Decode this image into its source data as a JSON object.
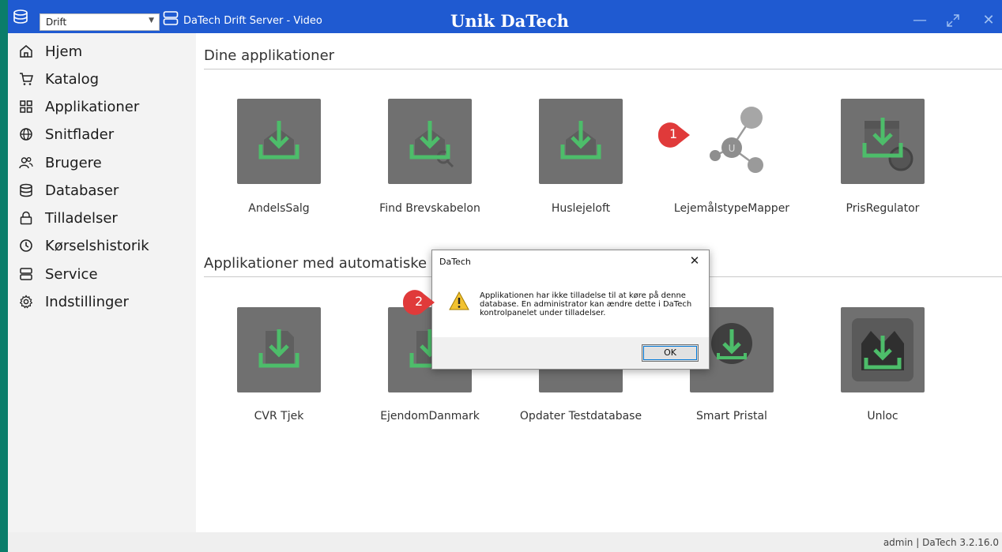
{
  "titlebar": {
    "db_select": "Drift",
    "server_name": "DaTech Drift Server - Video",
    "brand": "Unik DaTech"
  },
  "sidebar": {
    "items": [
      {
        "label": "Hjem",
        "icon": "home-icon"
      },
      {
        "label": "Katalog",
        "icon": "cart-icon"
      },
      {
        "label": "Applikationer",
        "icon": "apps-grid-icon"
      },
      {
        "label": "Snitflader",
        "icon": "globe-icon"
      },
      {
        "label": "Brugere",
        "icon": "users-icon"
      },
      {
        "label": "Databaser",
        "icon": "database-icon"
      },
      {
        "label": "Tilladelser",
        "icon": "lock-icon"
      },
      {
        "label": "Kørselshistorik",
        "icon": "clock-icon"
      },
      {
        "label": "Service",
        "icon": "server-icon"
      },
      {
        "label": "Indstillinger",
        "icon": "gear-icon"
      }
    ]
  },
  "main": {
    "section1_title": "Dine applikationer",
    "section1_apps": [
      {
        "label": "AndelsSalg",
        "icon": "download-tray-icon"
      },
      {
        "label": "Find Brevskabelon",
        "icon": "download-search-icon"
      },
      {
        "label": "Huslejeloft",
        "icon": "download-tray-icon"
      },
      {
        "label": "LejemålstypeMapper",
        "icon": "molecule-icon"
      },
      {
        "label": "PrisRegulator",
        "icon": "download-calendar-icon"
      }
    ],
    "section2_title": "Applikationer med automatiske kø",
    "section2_apps": [
      {
        "label": "CVR Tjek",
        "icon": "download-tray-icon"
      },
      {
        "label": "EjendomDanmark",
        "icon": "download-tray-icon"
      },
      {
        "label": "Opdater Testdatabase",
        "icon": "download-tray-icon"
      },
      {
        "label": "Smart Pristal",
        "icon": "download-circle-icon"
      },
      {
        "label": "Unloc",
        "icon": "download-house-icon"
      }
    ]
  },
  "dialog": {
    "title": "DaTech",
    "message": "Applikationen har ikke tilladelse til at køre på denne database. En administrator kan ændre dette i DaTech kontrolpanelet under tilladelser.",
    "ok_label": "OK"
  },
  "badges": {
    "first": "1",
    "second": "2"
  },
  "status": {
    "text": "admin | DaTech 3.2.16.0"
  },
  "colors": {
    "titlebar": "#1f5ad1",
    "accent_green": "#4dbd6a",
    "tile_gray": "#707070",
    "badge_red": "#e03a3a",
    "desktop": "#0a7d6a"
  }
}
